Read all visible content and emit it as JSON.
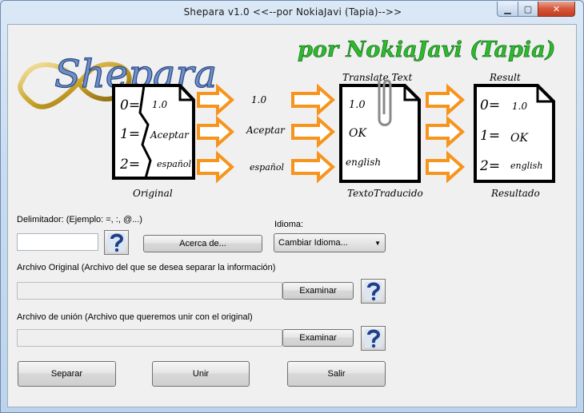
{
  "window": {
    "title": "Shepara v1.0 <<--por NokiaJavi (Tapia)-->>",
    "minimize_glyph": "▁",
    "maximize_glyph": "▢",
    "close_glyph": "✕"
  },
  "banner": {
    "logo_text": "Shepara",
    "author_text": "por NokiaJavi (Tapia)",
    "original_caption": "Original",
    "translate_header": "Translate Text",
    "translated_caption": "TextoTraducido",
    "result_header": "Result",
    "result_caption": "Resultado",
    "original_doc": [
      {
        "key": "0=",
        "val": "1.0"
      },
      {
        "key": "1=",
        "val": "Aceptar"
      },
      {
        "key": "2=",
        "val": "español"
      }
    ],
    "middle_words": [
      "1.0",
      "Aceptar",
      "español"
    ],
    "translated_doc": [
      "1.0",
      "OK",
      "english"
    ],
    "result_doc": [
      {
        "key": "0=",
        "val": "1.0"
      },
      {
        "key": "1=",
        "val": "OK"
      },
      {
        "key": "2=",
        "val": "english"
      }
    ],
    "colors": {
      "arrow": "#f7941d",
      "green": "#2eb82e",
      "logo_blue": "#3a5f9e"
    }
  },
  "form": {
    "delim_label": "Delimitador: (Ejemplo: =, :, @...)",
    "delim_value": "",
    "about_label": "Acerca de...",
    "idioma_label": "Idioma:",
    "idioma_selected": "Cambiar Idioma...",
    "orig_label": "Archivo Original (Archivo del que se desea separar la información)",
    "orig_value": "",
    "browse1_label": "Examinar",
    "union_label": "Archivo de unión (Archivo que queremos unir con el original)",
    "union_value": "",
    "browse2_label": "Examinar",
    "separar_label": "Separar",
    "unir_label": "Unir",
    "salir_label": "Salir",
    "help_icon": "help-question-icon"
  }
}
